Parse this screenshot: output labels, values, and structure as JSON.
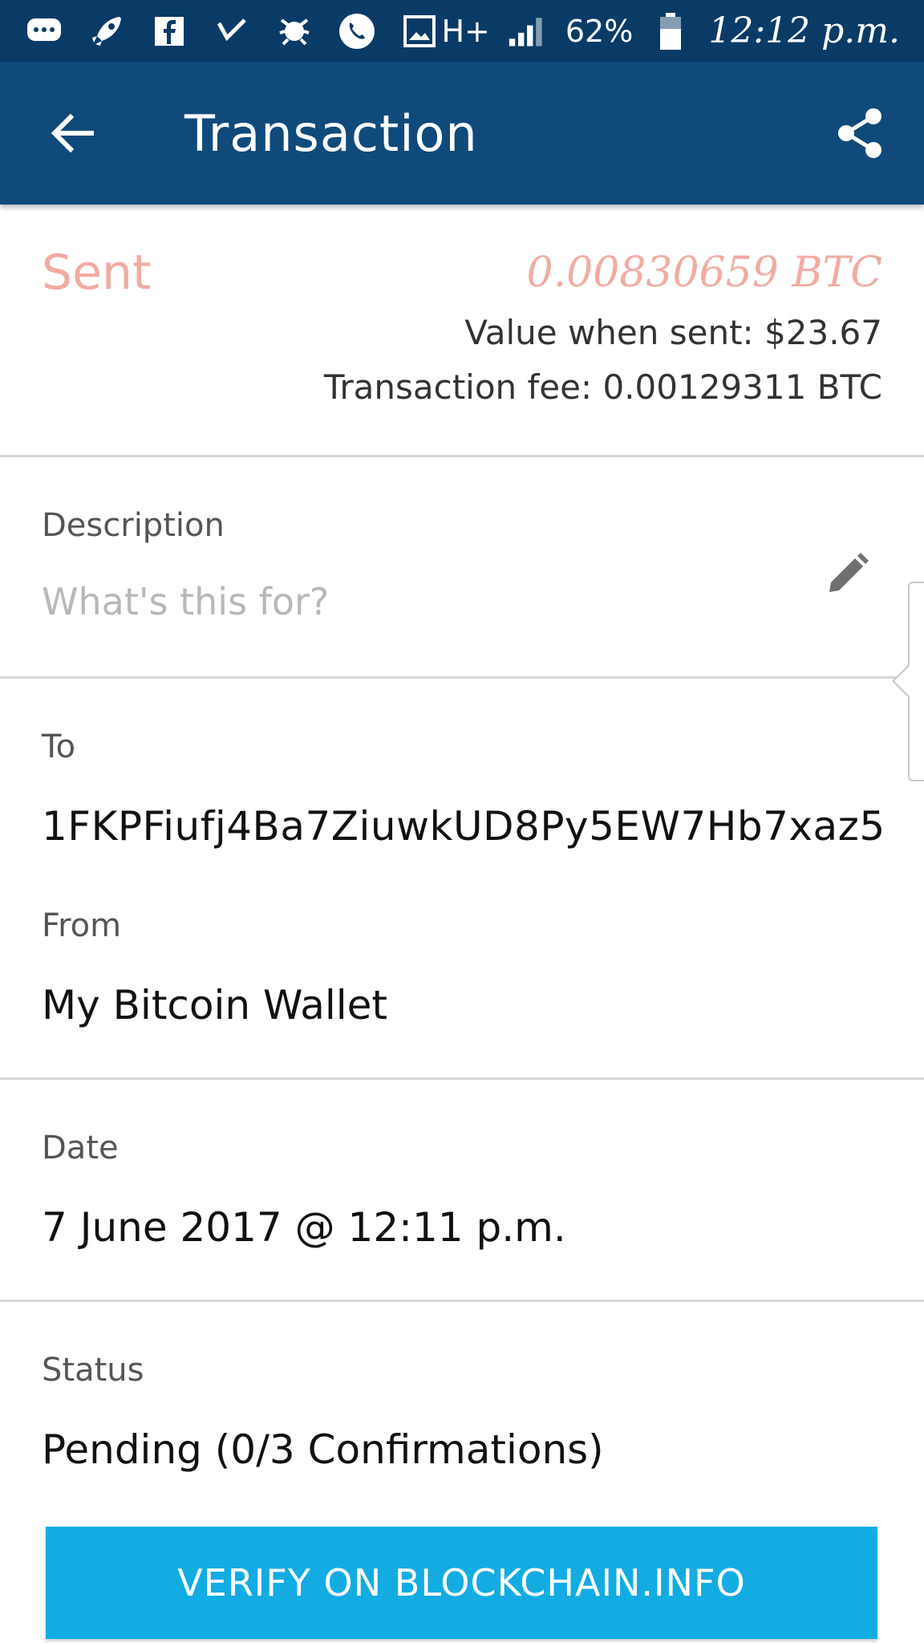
{
  "status_bar": {
    "icons": [
      "messages-icon",
      "rocket-icon",
      "facebook-icon",
      "checkmark-icon",
      "bug-icon",
      "phone-icon",
      "image-icon"
    ],
    "network": "H+",
    "battery_percent": "62%",
    "time": "12:12 p.m."
  },
  "app_bar": {
    "title": "Transaction"
  },
  "summary": {
    "direction": "Sent",
    "amount": "0.00830659 BTC",
    "value_when_sent": "Value when sent: $23.67",
    "transaction_fee": "Transaction fee: 0.00129311 BTC",
    "accent_color": "#f2aba3"
  },
  "description": {
    "label": "Description",
    "placeholder": "What's this for?"
  },
  "to": {
    "label": "To",
    "address": "1FKPFiufj4Ba7ZiuwkUD8Py5EW7Hb7xaz5"
  },
  "from": {
    "label": "From",
    "wallet": "My Bitcoin Wallet"
  },
  "date": {
    "label": "Date",
    "value": "7 June 2017 @ 12:11 p.m."
  },
  "status": {
    "label": "Status",
    "value": "Pending (0/3 Confirmations)"
  },
  "verify_button": {
    "label": "VERIFY ON BLOCKCHAIN.INFO",
    "color": "#12ace3"
  },
  "colors": {
    "status_bar": "#0a3b66",
    "app_bar": "#0f4a7b"
  }
}
